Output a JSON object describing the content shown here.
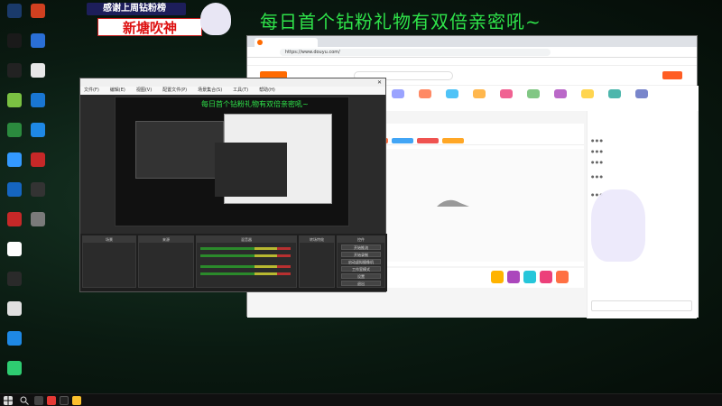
{
  "overlay": {
    "banner_top": "感谢上周钻粉榜",
    "banner_bottom": "新塘吹神",
    "headline": "每日首个钻粉礼物有双倍亲密吼~"
  },
  "desktop_icons": [
    {
      "label": "",
      "color": "#1a3a6a"
    },
    {
      "label": "",
      "color": "#d04020"
    },
    {
      "label": "",
      "color": "#1a1a1a"
    },
    {
      "label": "",
      "color": "#2a6fd6"
    },
    {
      "label": "",
      "color": "#222222"
    },
    {
      "label": "",
      "color": "#e8e8e8"
    },
    {
      "label": "",
      "color": "#7ac142"
    },
    {
      "label": "",
      "color": "#1976d2"
    },
    {
      "label": "",
      "color": "#2b8a3e"
    },
    {
      "label": "",
      "color": "#1e88e5"
    },
    {
      "label": "",
      "color": "#3399ff"
    },
    {
      "label": "",
      "color": "#c62828"
    },
    {
      "label": "",
      "color": "#1565c0"
    },
    {
      "label": "",
      "color": "#333333"
    },
    {
      "label": "",
      "color": "#c62828"
    },
    {
      "label": "",
      "color": "#7a7a7a"
    },
    {
      "label": "",
      "color": "#ffffff"
    },
    {
      "label": "",
      "color": "#2a2a2a"
    },
    {
      "label": "",
      "color": "#e0e0e0"
    },
    {
      "label": "",
      "color": "#1e88e5"
    },
    {
      "label": "",
      "color": "#2ecc71"
    }
  ],
  "browser": {
    "tab_label": "",
    "url": "https://www.douyu.com/",
    "bookmarks": "",
    "stream_title": "",
    "video_caption": ""
  },
  "obs": {
    "window_title": "",
    "menu": [
      "文件(F)",
      "编辑(E)",
      "视图(V)",
      "配置文件(P)",
      "场景集合(S)",
      "工具(T)",
      "帮助(H)"
    ],
    "preview_headline": "每日首个钻粉礼物有双倍亲密吼~",
    "docks": {
      "scenes": "场景",
      "sources": "来源",
      "mixer": "混音器",
      "transitions": "转场特效",
      "controls": "控件"
    },
    "controls_buttons": [
      "开始推流",
      "开始录制",
      "启动虚拟摄像机",
      "工作室模式",
      "设置",
      "退出"
    ]
  },
  "taskbar": {
    "time": "",
    "date": ""
  }
}
